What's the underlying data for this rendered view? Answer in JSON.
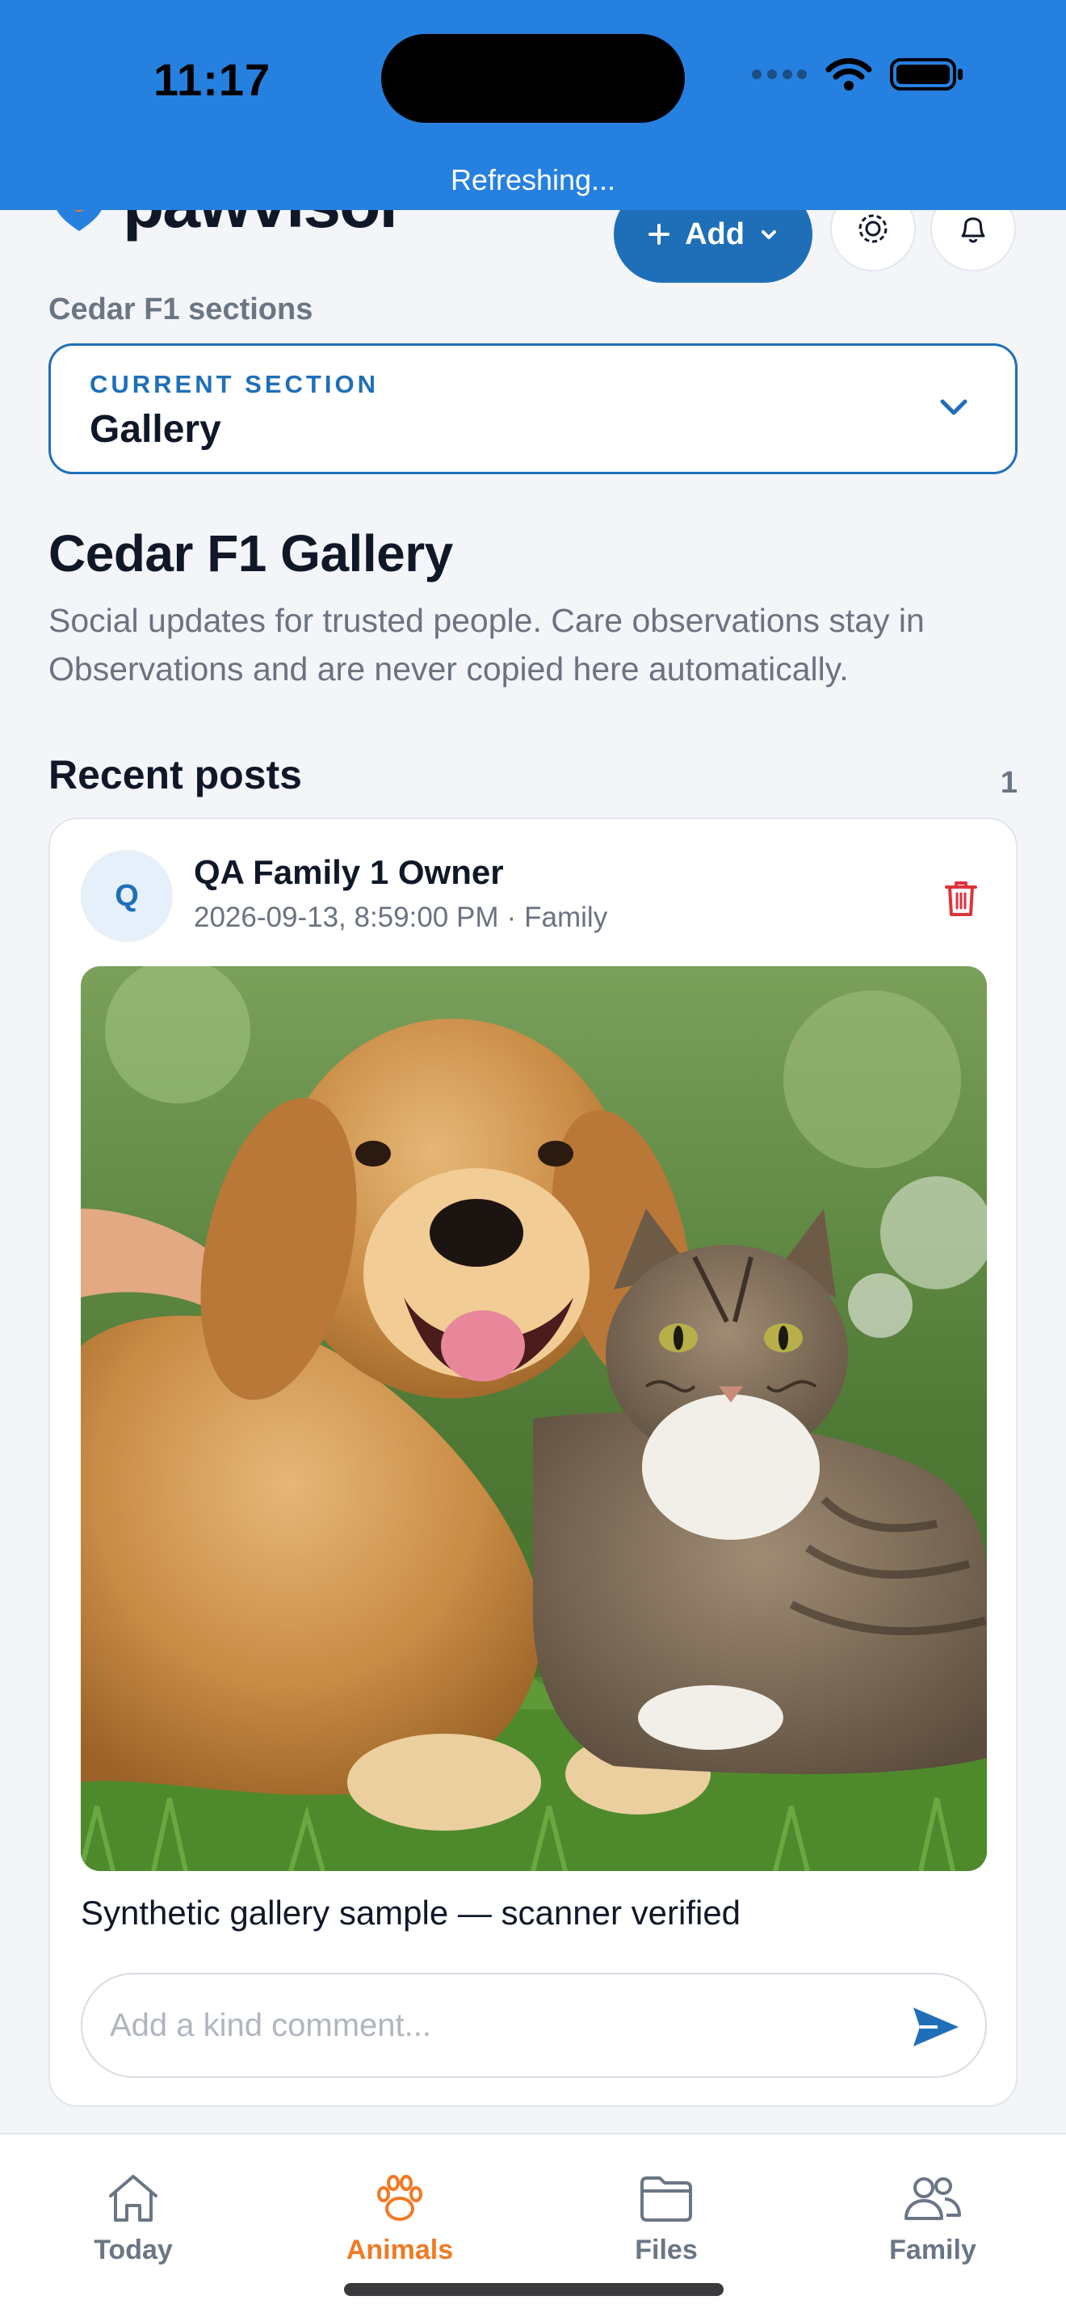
{
  "status_bar": {
    "time": "11:17",
    "refresh_text": "Refreshing...",
    "icons": [
      "signal-dots-icon",
      "wifi-icon",
      "battery-icon"
    ]
  },
  "header": {
    "logo_text": "pawvisor",
    "add_label": "Add",
    "icons": [
      "paw-logo-icon",
      "plus-icon",
      "chevron-down-icon",
      "gear-icon",
      "bell-icon"
    ]
  },
  "section_caption": "Cedar F1 sections",
  "section_select": {
    "label": "CURRENT SECTION",
    "value": "Gallery"
  },
  "page": {
    "title": "Cedar F1 Gallery",
    "description": "Social updates for trusted people. Care observations stay in Observations and are never copied here automatically."
  },
  "recent": {
    "title": "Recent posts",
    "count": "1"
  },
  "post": {
    "avatar_initial": "Q",
    "author": "QA Family 1 Owner",
    "timestamp": "2026-09-13, 8:59:00 PM",
    "separator": "·",
    "audience": "Family",
    "caption": "Synthetic gallery sample — scanner verified",
    "comment_placeholder": "Add a kind comment..."
  },
  "tabs": [
    {
      "label": "Today",
      "icon": "home-icon",
      "active": false
    },
    {
      "label": "Animals",
      "icon": "paw-icon",
      "active": true
    },
    {
      "label": "Files",
      "icon": "folder-icon",
      "active": false
    },
    {
      "label": "Family",
      "icon": "people-icon",
      "active": false
    }
  ],
  "colors": {
    "status_bar": "#2680e0",
    "primary": "#1f6fb8",
    "accent_active_tab": "#f07a24",
    "danger": "#e0323c"
  }
}
